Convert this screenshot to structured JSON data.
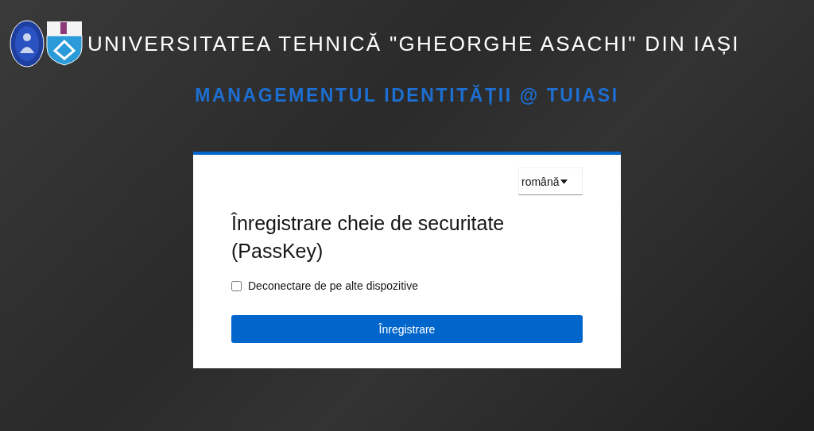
{
  "header": {
    "title": "UNIVERSITATEA TEHNICĂ \"GHEORGHE ASACHI\" DIN IAȘI",
    "subtitle": "MANAGEMENTUL IDENTITĂȚII @ TUIASI"
  },
  "card": {
    "language": "română",
    "heading": "Înregistrare cheie de securitate (PassKey)",
    "checkbox": {
      "label": "Deconectare de pe alte dispozitive",
      "checked": false
    },
    "button": "Înregistrare"
  }
}
